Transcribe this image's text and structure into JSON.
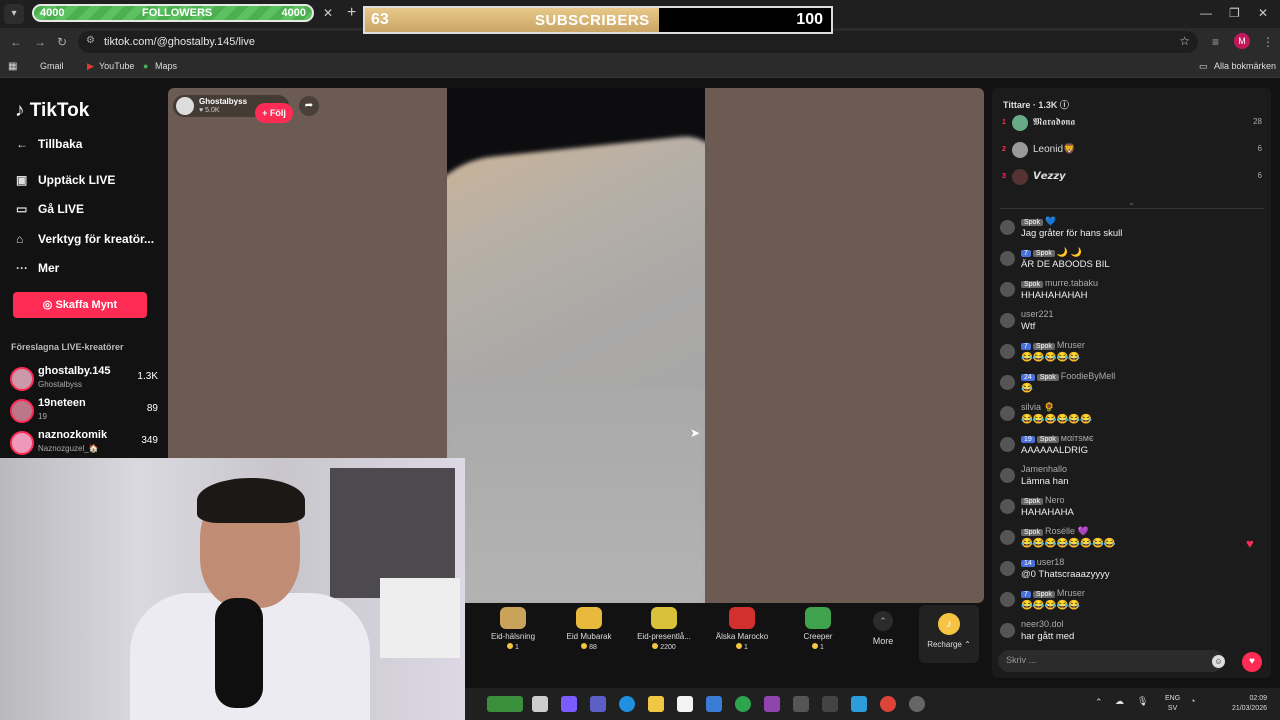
{
  "overlays": {
    "followers": {
      "current": "4000",
      "label": "FOLLOWERS",
      "goal": "4000"
    },
    "subscribers": {
      "current": "63",
      "label": "SUBSCRIBERS",
      "goal": "100",
      "progress": 0.63
    }
  },
  "browser": {
    "url": "tiktok.com/@ghostalby.145/live",
    "bookmarks": [
      "Gmail",
      "YouTube",
      "Maps"
    ],
    "all_bookmarks": "Alla bokmärken",
    "profile_initial": "M"
  },
  "sidebar": {
    "logo": "TikTok",
    "back": "Tillbaka",
    "items": [
      {
        "label": "Upptäck LIVE",
        "icon": "calendar-live-icon"
      },
      {
        "label": "Gå LIVE",
        "icon": "video-camera-icon"
      },
      {
        "label": "Verktyg för kreatör...",
        "icon": "home-tools-icon"
      },
      {
        "label": "Mer",
        "icon": "more-icon"
      }
    ],
    "coins_button": "Skaffa Mynt",
    "suggested_title": "Föreslagna LIVE-kreatörer",
    "creators": [
      {
        "name": "ghostalby.145",
        "sub": "Ghostalbyss",
        "count": "1.3K"
      },
      {
        "name": "19neteen",
        "sub": "19",
        "count": "89"
      },
      {
        "name": "naznozkomik",
        "sub": "Naznozguzel_🏠",
        "count": "349"
      }
    ]
  },
  "stream": {
    "host_name": "Ghostalbyss",
    "host_likes": "5.0K",
    "follow_label": "+ Följ"
  },
  "gifts": [
    {
      "name": "Eid-hälsning",
      "price": "1",
      "color": "#c9a35a"
    },
    {
      "name": "Eid Mubarak",
      "price": "88",
      "color": "#e8b93c"
    },
    {
      "name": "Eid-presentlå...",
      "price": "2200",
      "color": "#d9c23a"
    },
    {
      "name": "Älska Marocko",
      "price": "1",
      "color": "#d32f2f"
    },
    {
      "name": "Creeper",
      "price": "1",
      "color": "#3fa34d"
    }
  ],
  "gift_more": "More",
  "recharge": "Recharge",
  "chat": {
    "viewers_title": "Tittare",
    "viewers_count": "1.3K",
    "top_viewers": [
      {
        "rank": "1",
        "name": "𝕸𝖆𝖗𝖆𝖉𝖔𝖓𝖆",
        "score": "28"
      },
      {
        "rank": "2",
        "name": "Leonid🦁",
        "score": "6"
      },
      {
        "rank": "3",
        "name": "𝙑𝙚𝙯𝙯𝙮",
        "score": "6"
      }
    ],
    "messages": [
      {
        "level": "",
        "tag": "Spok",
        "user": "💙",
        "text": "Jag gråter för hans skull"
      },
      {
        "level": "7",
        "tag": "Spok",
        "user": "🌙 🌙",
        "text": "ÄR DE ABOODS BIL"
      },
      {
        "level": "",
        "tag": "Spok",
        "user": "murre.tabaku",
        "text": "HHAHAHAHAH"
      },
      {
        "level": "",
        "tag": "",
        "user": "user221",
        "text": "Wtf"
      },
      {
        "level": "7",
        "tag": "Spok",
        "user": "Mruser",
        "text": "😂😂😂😂😂"
      },
      {
        "level": "24",
        "tag": "Spok",
        "user": "FoodieByMell",
        "text": "😂"
      },
      {
        "level": "",
        "tag": "",
        "user": "silvia 🌻",
        "text": "😂😂😂😂😂😂"
      },
      {
        "level": "19",
        "tag": "Spok",
        "user": "мαітѕмє",
        "text": "AAAAAALDRIG"
      },
      {
        "level": "",
        "tag": "",
        "user": "Jamenhallo",
        "text": "Lämna han"
      },
      {
        "level": "",
        "tag": "Spok",
        "user": "Nero",
        "text": "HAHAHAHA"
      },
      {
        "level": "",
        "tag": "Spok",
        "user": "Roséllе 💜",
        "text": "😂😂😂😂😂😂😂😂"
      },
      {
        "level": "14",
        "tag": "",
        "user": "user18",
        "text": "@0 Thatscraaazyyyy"
      },
      {
        "level": "7",
        "tag": "Spok",
        "user": "Mruser",
        "text": "😂😂😂😂😂"
      },
      {
        "level": "",
        "tag": "",
        "user": "neer30.dol",
        "text": "har gått med"
      }
    ],
    "input_placeholder": "Skriv ..."
  },
  "taskbar": {
    "lang": "ENG",
    "region": "SV",
    "time": "02:09",
    "date": "21/03/2026"
  }
}
